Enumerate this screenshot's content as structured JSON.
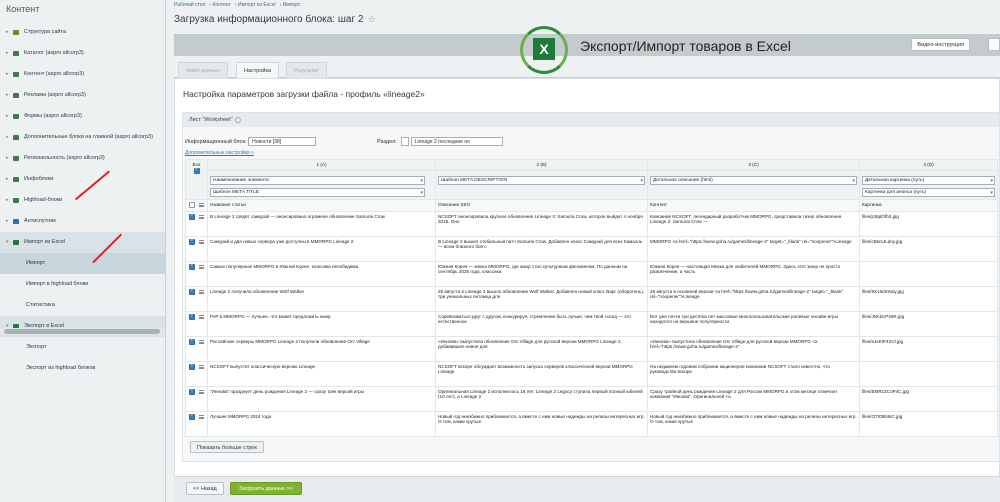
{
  "sidebar": {
    "title": "Контент",
    "items": [
      {
        "label": "Структура сайта",
        "icon": "folder-icon",
        "color": "#6b8e23"
      },
      {
        "label": "Каталог (aspro allcorp3)",
        "icon": "catalog-icon",
        "color": "#3a7d44"
      },
      {
        "label": "Контент (aspro allcorp3)",
        "icon": "content-icon",
        "color": "#3a7d44"
      },
      {
        "label": "Реклама (aspro allcorp3)",
        "icon": "ad-icon",
        "color": "#3a7d44"
      },
      {
        "label": "Формы (aspro allcorp3)",
        "icon": "forms-icon",
        "color": "#3a7d44"
      },
      {
        "label": "Дополнительные блоки на главной (aspro allcorp3)",
        "icon": "blocks-icon",
        "color": "#3a7d44"
      },
      {
        "label": "Региональность (aspro allcorp3)",
        "icon": "region-icon",
        "color": "#3a7d44"
      },
      {
        "label": "Инфоблоки",
        "icon": "iblock-icon",
        "color": "#3a7d44"
      },
      {
        "label": "Highload-блоки",
        "icon": "highload-icon",
        "color": "#3a7d44"
      },
      {
        "label": "Антиспутник",
        "icon": "shield-icon",
        "color": "#2d74b5"
      },
      {
        "label": "Импорт из Excel",
        "icon": "excel-icon",
        "color": "#1f7a3a"
      },
      {
        "label": "Импорт",
        "sub": true
      },
      {
        "label": "Импорт в highload блоки",
        "sub": true
      },
      {
        "label": "Статистика",
        "sub": true
      },
      {
        "label": "Экспорт в Excel",
        "icon": "excel-icon",
        "color": "#1f7a3a"
      },
      {
        "label": "Экспорт",
        "sub": true
      },
      {
        "label": "Экспорт из highload блоков",
        "sub": true
      }
    ]
  },
  "breadcrumbs": [
    "Рабочий стол",
    "Контент",
    "Импорт из Excel",
    "Импорт"
  ],
  "page_title": "Загрузка информационного блока: шаг 2",
  "star": "☆",
  "banner": {
    "text": "Экспорт/Импорт товаров в Excel",
    "stars": "★★★★★",
    "x": "X"
  },
  "toolbar": {
    "video_button": "Видео-инструкция"
  },
  "tabs": [
    "Файл данных",
    "Настройка",
    "Результат"
  ],
  "card_title": "Настройка параметров загрузки файла - профиль «lineage2»",
  "sheet": {
    "title": "Лист \"Worksheet\"",
    "iblock_label": "Информационный блок:",
    "iblock_value": "Новости [38]",
    "section_label": "Раздел:",
    "section_value": "Lineage 2 последние но",
    "advanced_link": "Дополнительные настройки »",
    "all_label": "Все",
    "columns": [
      "1 (A)",
      "2 (B)",
      "3 (C)",
      "4 (D)"
    ],
    "mapping": [
      [
        "Наименование элемента",
        "Шаблон META TITLE"
      ],
      [
        "Шаблон META DESCRIPTION"
      ],
      [
        "Детальное описание (html)"
      ],
      [
        "Детальная картинка (путь)",
        "Картинка для анонса (путь)"
      ]
    ],
    "field_names": [
      "Название статьи",
      "Описание SEO",
      "Контент",
      "Картинка"
    ],
    "rows": [
      [
        "В Lineage 2 грядёт самурай — анонсировано огромное обновление Samurai Crow",
        "NCSOFT анонсировала крупное обновление Lineage II: Samurai Crow, которое выйдет 4 ноября 2025. Оно",
        "Компания NCSOFT, легендарный разработчик MMORPG, представила тизер обновления Lineage 2: Samurai Crow —",
        "files/jcBqlOfb3.jpg"
      ],
      [
        "Самурай и два новых сервера уже доступны в MMORPG Lineage 2",
        "В Lineage 2 вышел глобальный патч Samurai Crow. Добавлен класс Самурай для всех Камаэль — всем близкого боя с",
        "MMORPG <a href=\"https://www.goha.ru/games/lineage-2\" target=\"_blank\" rel=\"noopener\">Lineage",
        "files/cBsmJLdny.jpg"
      ],
      [
        "Самые популярные MMORPG в Южной Корее: классика непобедима",
        "Южная Корея — мекка MMORPG, где жанр стал культурным феноменом. По данным на сентябрь 2025 года, классика",
        "Южная Корея — настоящая Мекка для любителей MMORPG. Здесь этот жанр не просто развлечение, а часть",
        ""
      ],
      [
        "Lineage 2 получила обновление Wolf Walker",
        "29 августа в Lineage 2 вышло обновление Wolf Walker. Добавлен новый класс Варг (оборотень), три уникальных питомца для",
        "29 августа в основной версии <a href=\"https://www.goha.ru/games/lineage-2\" target=\"_blank\" rel=\"noopener\">Lineage",
        "files/9X16dmNoy.jpg"
      ],
      [
        "PvP в MMORPG — лучшее, что может предложить жанр",
        "Соревноваться друг с другом, конкурируя, стремление быть лучше, чем твой сосед — это естественное",
        "Вот уже почти три десятка лет массовые многопользовательские ролевые онлайн-игры находятся на вершине популярности",
        "files/JNnDcP46R.jpg"
      ],
      [
        "Российские серверы MMORPG Lineage 2 получили обновление Orc Village",
        "«Иннова» выпустила обновление Orc Village для русской версии MMORPG Lineage 2, добавившее новое для",
        "«Иннова» выпустила обновление Orc Village для русской версии MMORPG <a href=\"https://www.goha.ru/games/lineage-2\"",
        "files/eJxKtP4SVl.jpg"
      ],
      [
        "NCSOFT выпустит классическую версию Lineage",
        "NCSOFT вскоре обсуждает возможность запуска серверов классической версии MMORPG Lineage.",
        "На недавнем годовом собрании акционеров компании NCSOFT стало известно, что руководство вскоре",
        ""
      ],
      [
        "\"Иннова\" празднует день рождения Lineage 2 — сразу трек версий игры",
        "Оригинальная Lineage 2 исполнилось 16 лет. Lineage 2 Legacy ступила первый полный юбилей (10 лет), а Lineage 2",
        "Сразу тройной день рождения Lineage 2 для России MMORPG в этом месяце отмечает компания \"Иннова\". Оригинальной <a",
        "files/EMRzZCoP4C.jpg"
      ],
      [
        "Лучшие MMORPG 2024 года",
        "Новый год неизбежно приближается, а вместе с ним новые надежды на релизы интересных игр. О том, какие крутые",
        "Новый год неизбежно приближается, а вместе с ним новые надежды на релизы интересных игр. О том, какие крутые",
        "files/OTlOBl46C.jpg"
      ]
    ]
  },
  "show_more_button": "Показать больше строк",
  "back_button": "<< Назад",
  "load_button": "Загрузить данные >>"
}
